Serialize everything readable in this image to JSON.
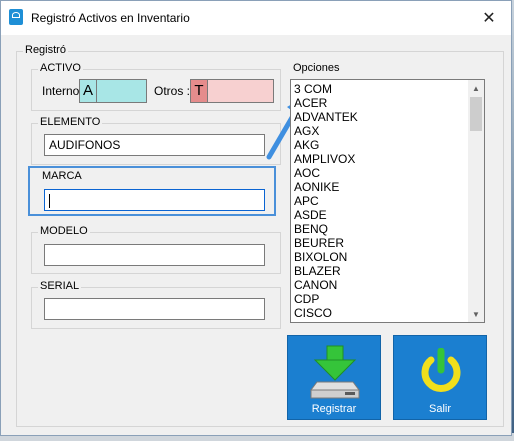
{
  "window": {
    "title": "Registró Activos en Inventario"
  },
  "colors": {
    "highlight": "#4a90d9",
    "button_bg": "#1b7fd0",
    "prefix_a_bg": "#a8e6e6",
    "prefix_t_bg": "#f7d0d0",
    "prefix_t_letter_bg": "#e58c8c"
  },
  "registro": {
    "label": "Registró",
    "activo": {
      "label": "ACTIVO",
      "interno_label": "Interno :",
      "interno_prefix": "A",
      "otros_label": "Otros :",
      "otros_prefix": "T"
    },
    "elemento": {
      "label": "ELEMENTO",
      "value": "AUDIFONOS"
    },
    "marca": {
      "label": "MARCA",
      "value": ""
    },
    "modelo": {
      "label": "MODELO",
      "value": ""
    },
    "serial": {
      "label": "SERIAL",
      "value": ""
    }
  },
  "opciones": {
    "label": "Opciones",
    "items": [
      "3 COM",
      "ACER",
      "ADVANTEK",
      "AGX",
      "AKG",
      "AMPLIVOX",
      "AOC",
      "AONIKE",
      "APC",
      "ASDE",
      "BENQ",
      "BEURER",
      "BIXOLON",
      "BLAZER",
      "CANON",
      "CDP",
      "CISCO"
    ]
  },
  "buttons": {
    "registrar": {
      "label": "Registrar",
      "icon": "download-drive-icon"
    },
    "salir": {
      "label": "Salir",
      "icon": "power-icon"
    }
  }
}
